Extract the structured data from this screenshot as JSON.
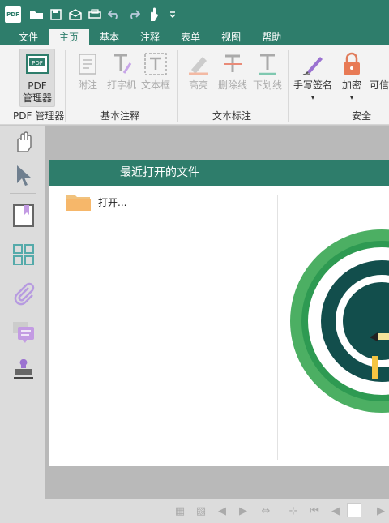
{
  "titlebar": {
    "logo_text": "PDF"
  },
  "menu": {
    "tabs": [
      "文件",
      "主页",
      "基本",
      "注释",
      "表单",
      "视图",
      "帮助"
    ],
    "active": "主页"
  },
  "ribbon": {
    "pdf_manager": "PDF\n管理器",
    "pdf_manager_l1": "PDF",
    "pdf_manager_l2": "管理器",
    "note": "附注",
    "typewriter": "打字机",
    "textbox": "文本框",
    "highlight": "高亮",
    "strikeout": "删除线",
    "underline": "下划线",
    "signature": "手写签名",
    "encrypt": "加密",
    "trusted": "可信",
    "groups": {
      "pdf_manager": "PDF 管理器",
      "basic_annot": "基本注释",
      "text_mark": "文本标注",
      "security": "安全"
    }
  },
  "panel": {
    "title": "最近打开的文件",
    "open_label": "打开..."
  },
  "colors": {
    "brand": "#2e7d6b",
    "ribbon_bg": "#f3f3f3"
  }
}
